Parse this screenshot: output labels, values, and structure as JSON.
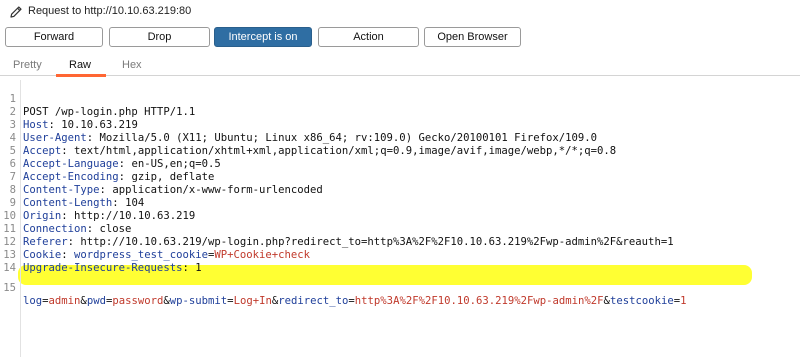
{
  "header": {
    "title": "Request to http://10.10.63.219:80"
  },
  "toolbar": {
    "forward": "Forward",
    "drop": "Drop",
    "intercept": "Intercept is on",
    "action": "Action",
    "open_browser": "Open Browser"
  },
  "tabs": [
    "Pretty",
    "Raw",
    "Hex"
  ],
  "selected_tab": "Raw",
  "colors": {
    "accent": "#ff6633",
    "button_active": "#2f6ea3",
    "header_name": "#1f3f9a",
    "param_value": "#c0392b",
    "highlight": "#ffff33"
  },
  "request": {
    "line_numbers": [
      "1",
      "2",
      "3",
      "4",
      "5",
      "6",
      "7",
      "8",
      "9",
      "10",
      "11",
      "12",
      "13",
      "14",
      "15"
    ],
    "request_line": "POST /wp-login.php HTTP/1.1",
    "headers": [
      {
        "name": "Host",
        "value": "10.10.63.219"
      },
      {
        "name": "User-Agent",
        "value": "Mozilla/5.0 (X11; Ubuntu; Linux x86_64; rv:109.0) Gecko/20100101 Firefox/109.0"
      },
      {
        "name": "Accept",
        "value": "text/html,application/xhtml+xml,application/xml;q=0.9,image/avif,image/webp,*/*;q=0.8"
      },
      {
        "name": "Accept-Language",
        "value": "en-US,en;q=0.5"
      },
      {
        "name": "Accept-Encoding",
        "value": "gzip, deflate"
      },
      {
        "name": "Content-Type",
        "value": "application/x-www-form-urlencoded"
      },
      {
        "name": "Content-Length",
        "value": "104"
      },
      {
        "name": "Origin",
        "value": "http://10.10.63.219"
      },
      {
        "name": "Connection",
        "value": "close"
      },
      {
        "name": "Referer",
        "value": "http://10.10.63.219/wp-login.php?redirect_to=http%3A%2F%2F10.10.63.219%2Fwp-admin%2F&reauth=1"
      },
      {
        "name": "Cookie",
        "value_name": "wordpress_test_cookie",
        "value_val": "WP+Cookie+check"
      },
      {
        "name": "Upgrade-Insecure-Requests",
        "value": "1"
      }
    ],
    "body_params": [
      {
        "name": "log",
        "value": "admin"
      },
      {
        "name": "pwd",
        "value": "password"
      },
      {
        "name": "wp-submit",
        "value": "Log+In"
      },
      {
        "name": "redirect_to",
        "value": "http%3A%2F%2F10.10.63.219%2Fwp-admin%2F"
      },
      {
        "name": "testcookie",
        "value": "1"
      }
    ]
  }
}
